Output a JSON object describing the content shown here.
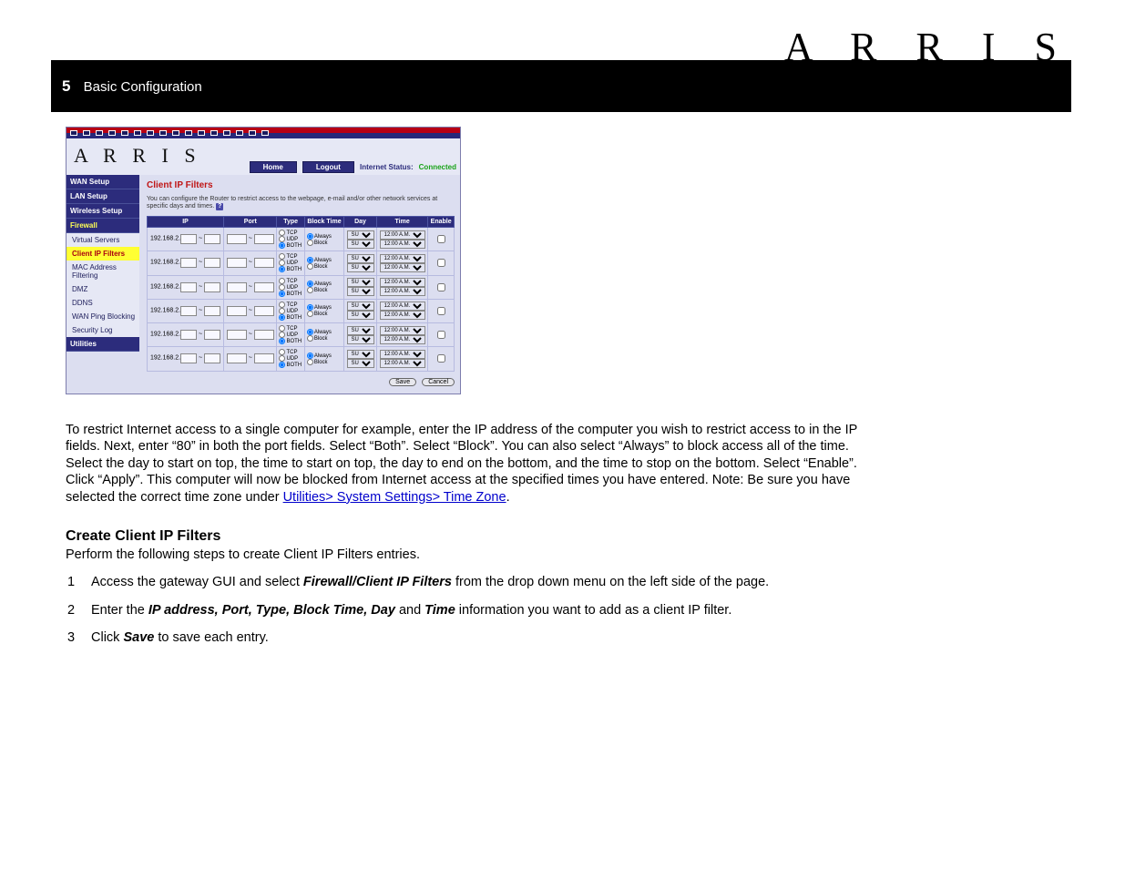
{
  "brand": "A R R I S",
  "brand_mini": "A R R I S",
  "header": {
    "chapter_num": "5",
    "chapter_title": "Basic Configuration"
  },
  "router": {
    "buttons": {
      "home": "Home",
      "logout": "Logout"
    },
    "status_label": "Internet Status:",
    "status_value": "Connected",
    "sidebar": {
      "wan": "WAN Setup",
      "lan": "LAN Setup",
      "wireless": "Wireless Setup",
      "firewall": "Firewall",
      "virtual": "Virtual Servers",
      "clientip": "Client IP Filters",
      "mac": "MAC Address Filtering",
      "dmz": "DMZ",
      "ddns": "DDNS",
      "wanping": "WAN Ping Blocking",
      "seclog": "Security Log",
      "utilities": "Utilities"
    },
    "page": {
      "title": "Client IP Filters",
      "desc": "You can configure the Router to restrict access to the webpage, e-mail and/or other network services at specific days and times.",
      "help": "?",
      "cols": {
        "ip": "IP",
        "port": "Port",
        "type": "Type",
        "bt": "Block Time",
        "day": "Day",
        "time": "Time",
        "en": "Enable"
      },
      "ip_prefix": "192.168.2.",
      "dash": "~",
      "type_tcp": "TCP",
      "type_udp": "UDP",
      "type_both": "BOTH",
      "bt_always": "Always",
      "bt_block": "Block",
      "day_opt": "SUN",
      "time_opt": "12:00 A.M.",
      "save": "Save",
      "cancel": "Cancel"
    }
  },
  "doc": {
    "p1": "To restrict Internet access to a single computer for example, enter the IP address of the computer you wish to restrict access to in the IP fields. Next, enter “80” in both the port fields. Select “Both”. Select “Block”. You can also select “Always” to block access all of the time. Select the day to start on top, the time to start on top, the day to end on the bottom, and the time to stop on the bottom. Select “Enable”. Click “Apply”. This computer will now be blocked from Internet access at the specified times you have entered. Note: Be sure you have selected the correct time zone under ",
    "link": "Utilities> System Settings> Time Zone",
    "p1b": ".",
    "sub": "Create Client IP Filters",
    "steps_intro": "Perform the following steps to create Client IP Filters entries.",
    "s1a": "Access the gateway GUI and select ",
    "s1b": "Firewall/Client IP Filters",
    "s1c": " from the drop down menu on the left side of the page.",
    "s2a": "Enter the ",
    "s2b": "IP address, Port, Type, Block Time, Day",
    "s2c": " and ",
    "s2d": "Time",
    "s2e": " information you want to add as a client IP filter.",
    "s3a": "Click ",
    "s3b": "Save",
    "s3c": " to save each entry."
  }
}
